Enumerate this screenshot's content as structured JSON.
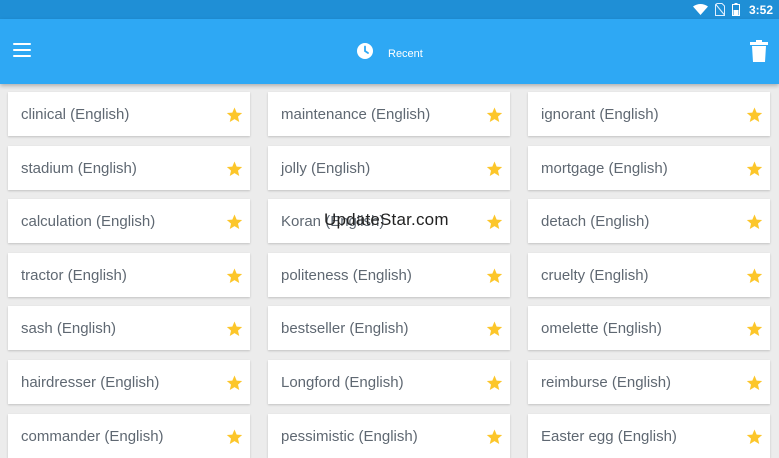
{
  "status_bar": {
    "time": "3:52"
  },
  "toolbar": {
    "menu_icon": "hamburger-menu-icon",
    "title_icon": "clock-icon",
    "title": "Recent",
    "action_icon": "trash-icon"
  },
  "colors": {
    "status_bar": "#1f8fd6",
    "toolbar": "#2ea8f4",
    "background": "#ececec",
    "star": "#fcc62a",
    "card_text": "#5f6872"
  },
  "words": [
    {
      "label": "clinical (English)",
      "favorite": true
    },
    {
      "label": "maintenance (English)",
      "favorite": true
    },
    {
      "label": "ignorant (English)",
      "favorite": true
    },
    {
      "label": "stadium (English)",
      "favorite": true
    },
    {
      "label": "jolly (English)",
      "favorite": true
    },
    {
      "label": "mortgage (English)",
      "favorite": true
    },
    {
      "label": "calculation (English)",
      "favorite": true
    },
    {
      "label": "Koran (English)",
      "favorite": true
    },
    {
      "label": "detach (English)",
      "favorite": true
    },
    {
      "label": "tractor (English)",
      "favorite": true
    },
    {
      "label": "politeness (English)",
      "favorite": true
    },
    {
      "label": "cruelty (English)",
      "favorite": true
    },
    {
      "label": "sash (English)",
      "favorite": true
    },
    {
      "label": "bestseller (English)",
      "favorite": true
    },
    {
      "label": "omelette (English)",
      "favorite": true
    },
    {
      "label": "hairdresser (English)",
      "favorite": true
    },
    {
      "label": "Longford (English)",
      "favorite": true
    },
    {
      "label": "reimburse (English)",
      "favorite": true
    },
    {
      "label": "commander (English)",
      "favorite": true
    },
    {
      "label": "pessimistic (English)",
      "favorite": true
    },
    {
      "label": "Easter egg (English)",
      "favorite": true
    }
  ],
  "watermark": "UpdateStar.com"
}
